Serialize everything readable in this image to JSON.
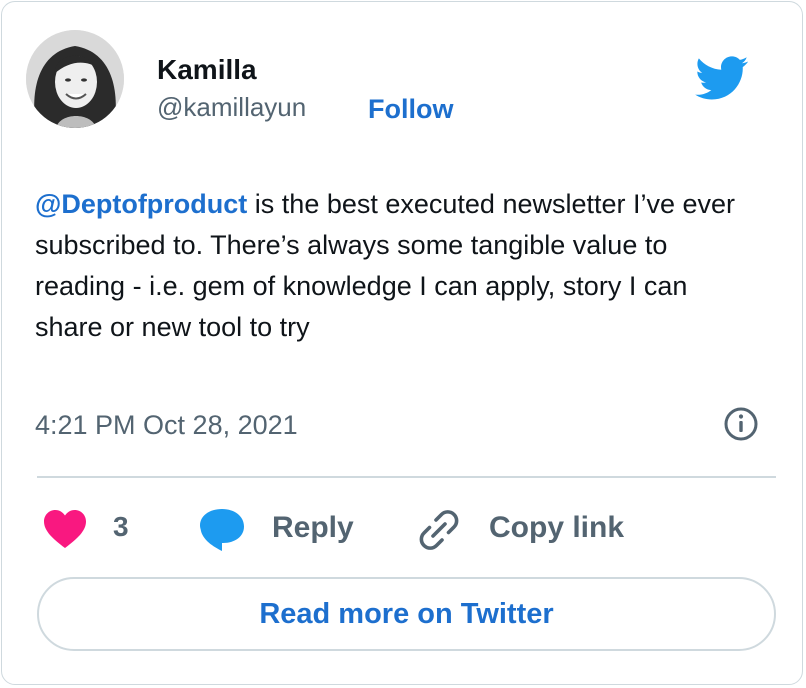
{
  "colors": {
    "accent": "#1d6fce",
    "twitter_blue": "#1d9bf0",
    "heart": "#f91880",
    "muted_text": "#536471",
    "border": "#cfd9de"
  },
  "author": {
    "name": "Kamilla",
    "handle": "@kamillayun",
    "follow_label": "Follow",
    "avatar_icon": "user-photo"
  },
  "tweet": {
    "mention": "@Deptofproduct",
    "text_after_mention": " is the best executed newsletter I’ve ever subscribed to. There’s always some tangible value to reading - i.e. gem of knowledge I can apply, story I can share or new tool to try",
    "timestamp": "4:21 PM Oct 28, 2021"
  },
  "actions": {
    "like_count": "3",
    "reply_label": "Reply",
    "copy_link_label": "Copy link"
  },
  "footer": {
    "read_more_label": "Read more on Twitter"
  },
  "icons": {
    "brand": "twitter-bird-icon",
    "info": "info-icon",
    "like": "heart-icon",
    "reply": "reply-bubble-icon",
    "copy": "link-icon"
  }
}
